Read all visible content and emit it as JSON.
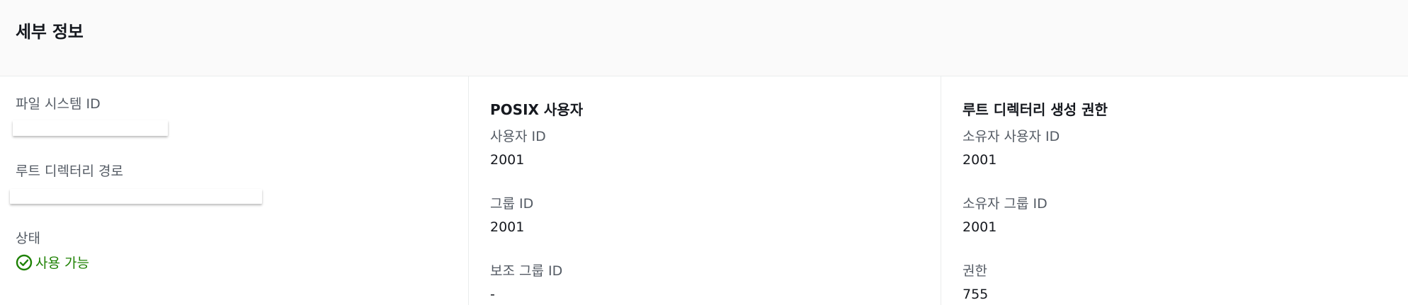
{
  "header": {
    "title": "세부 정보"
  },
  "general": {
    "fs_id_label": "파일 시스템 ID",
    "root_path_label": "루트 디렉터리 경로",
    "state_label": "상태",
    "state_value": "사용 가능",
    "state_color": "#1d8102",
    "state_icon": "check-circle-icon"
  },
  "posix": {
    "title": "POSIX 사용자",
    "uid_label": "사용자 ID",
    "uid_value": "2001",
    "gid_label": "그룹 ID",
    "gid_value": "2001",
    "secondary_gid_label": "보조 그룹 ID",
    "secondary_gid_value": "-"
  },
  "root_perm": {
    "title": "루트 디렉터리 생성 권한",
    "owner_uid_label": "소유자 사용자 ID",
    "owner_uid_value": "2001",
    "owner_gid_label": "소유자 그룹 ID",
    "owner_gid_value": "2001",
    "perm_label": "권한",
    "perm_value": "755"
  }
}
